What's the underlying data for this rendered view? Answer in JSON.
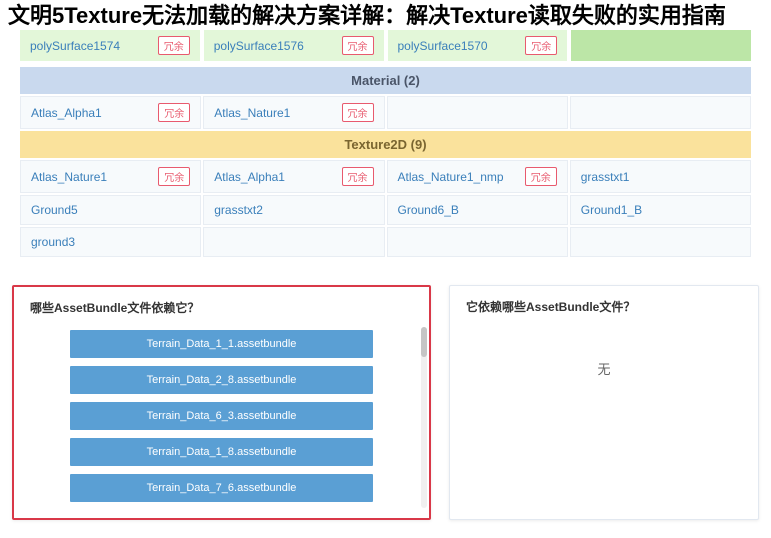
{
  "page_title": "文明5Texture无法加载的解决方案详解：解决Texture读取失败的实用指南",
  "badge_label": "冗余",
  "poly_row": [
    {
      "name": "polySurface1574"
    },
    {
      "name": "polySurface1576"
    },
    {
      "name": "polySurface1570"
    },
    {
      "name": ""
    }
  ],
  "material": {
    "header": "Material (2)",
    "rows": [
      [
        {
          "name": "Atlas_Alpha1",
          "badge": true
        },
        {
          "name": "Atlas_Nature1",
          "badge": true
        },
        {
          "name": "",
          "badge": false
        },
        {
          "name": "",
          "badge": false
        }
      ]
    ]
  },
  "texture": {
    "header": "Texture2D (9)",
    "rows": [
      [
        {
          "name": "Atlas_Nature1",
          "badge": true
        },
        {
          "name": "Atlas_Alpha1",
          "badge": true
        },
        {
          "name": "Atlas_Nature1_nmp",
          "badge": true
        },
        {
          "name": "grasstxt1",
          "badge": false
        }
      ],
      [
        {
          "name": "Ground5",
          "badge": false
        },
        {
          "name": "grasstxt2",
          "badge": false
        },
        {
          "name": "Ground6_B",
          "badge": false
        },
        {
          "name": "Ground1_B",
          "badge": false
        }
      ],
      [
        {
          "name": "ground3",
          "badge": false
        },
        {
          "name": "",
          "badge": false
        },
        {
          "name": "",
          "badge": false
        },
        {
          "name": "",
          "badge": false
        }
      ]
    ]
  },
  "left_panel": {
    "title": "哪些AssetBundle文件依赖它？",
    "bundles": [
      "Terrain_Data_1_1.assetbundle",
      "Terrain_Data_2_8.assetbundle",
      "Terrain_Data_6_3.assetbundle",
      "Terrain_Data_1_8.assetbundle",
      "Terrain_Data_7_6.assetbundle"
    ]
  },
  "right_panel": {
    "title": "它依赖哪些AssetBundle文件？",
    "content": "无"
  }
}
